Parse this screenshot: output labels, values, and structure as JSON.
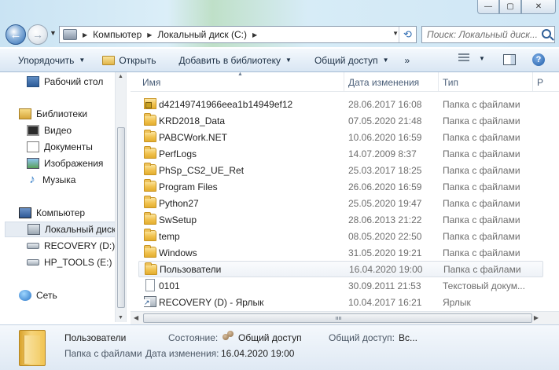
{
  "window": {
    "caption_min": "—",
    "caption_max": "▢",
    "caption_close": "✕"
  },
  "address_bar": {
    "crumbs": [
      "Компьютер",
      "Локальный диск (C:)"
    ],
    "search_placeholder": "Поиск: Локальный диск..."
  },
  "toolbar": {
    "organize": "Упорядочить",
    "open": "Открыть",
    "add_library": "Добавить в библиотеку",
    "share": "Общий доступ",
    "more": "»"
  },
  "nav_pane": {
    "desktop": "Рабочий стол",
    "libraries": "Библиотеки",
    "video": "Видео",
    "documents": "Документы",
    "images": "Изображения",
    "music": "Музыка",
    "computer": "Компьютер",
    "local_disk": "Локальный диск",
    "recovery": "RECOVERY (D:)",
    "hp_tools": "HP_TOOLS (E:)",
    "network": "Сеть"
  },
  "columns": {
    "name": "Имя",
    "date": "Дата изменения",
    "type": "Тип",
    "size": "Р"
  },
  "files": [
    {
      "name": "d42149741966eea1b14949ef12",
      "date": "28.06.2017 16:08",
      "type": "Папка с файлами",
      "icon": "lock-folder-icon"
    },
    {
      "name": "KRD2018_Data",
      "date": "07.05.2020 21:48",
      "type": "Папка с файлами",
      "icon": "folder-icon"
    },
    {
      "name": "PABCWork.NET",
      "date": "10.06.2020 16:59",
      "type": "Папка с файлами",
      "icon": "folder-icon"
    },
    {
      "name": "PerfLogs",
      "date": "14.07.2009 8:37",
      "type": "Папка с файлами",
      "icon": "folder-icon"
    },
    {
      "name": "PhSp_CS2_UE_Ret",
      "date": "25.03.2017 18:25",
      "type": "Папка с файлами",
      "icon": "folder-icon"
    },
    {
      "name": "Program Files",
      "date": "26.06.2020 16:59",
      "type": "Папка с файлами",
      "icon": "folder-icon"
    },
    {
      "name": "Python27",
      "date": "25.05.2020 19:47",
      "type": "Папка с файлами",
      "icon": "folder-icon"
    },
    {
      "name": "SwSetup",
      "date": "28.06.2013 21:22",
      "type": "Папка с файлами",
      "icon": "folder-icon"
    },
    {
      "name": "temp",
      "date": "08.05.2020 22:50",
      "type": "Папка с файлами",
      "icon": "folder-icon"
    },
    {
      "name": "Windows",
      "date": "31.05.2020 19:21",
      "type": "Папка с файлами",
      "icon": "folder-icon"
    },
    {
      "name": "Пользователи",
      "date": "16.04.2020 19:00",
      "type": "Папка с файлами",
      "icon": "folder-icon",
      "selected": true
    },
    {
      "name": "0101",
      "date": "30.09.2011 21:53",
      "type": "Текстовый докум...",
      "icon": "file-icon"
    },
    {
      "name": "RECOVERY (D) - Ярлык",
      "date": "10.04.2017 16:21",
      "type": "Ярлык",
      "icon": "shortcut-icon"
    }
  ],
  "details": {
    "name": "Пользователи",
    "kind": "Папка с файлами",
    "state_label": "Состояние:",
    "state_value": "Общий доступ",
    "date_label": "Дата изменения:",
    "date_value": "16.04.2020 19:00",
    "share_label": "Общий доступ:",
    "share_value": "Вс..."
  }
}
